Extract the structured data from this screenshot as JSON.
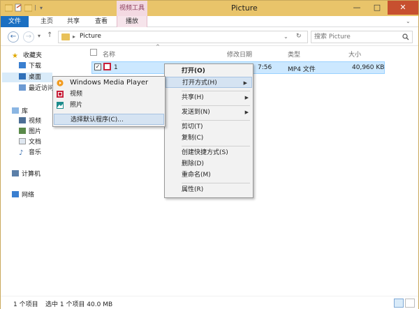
{
  "window": {
    "title": "Picture"
  },
  "ribbon": {
    "contextual_group": "视频工具",
    "tabs": [
      "文件",
      "主页",
      "共享",
      "查看",
      "播放"
    ]
  },
  "address": {
    "path": "Picture",
    "search_placeholder": "搜索 Picture"
  },
  "nav": {
    "favorites": "收藏夹",
    "downloads": "下载",
    "desktop": "桌面",
    "recent": "最近访问的位置",
    "libraries": "库",
    "videos": "视频",
    "pictures": "图片",
    "documents": "文档",
    "music": "音乐",
    "computer": "计算机",
    "network": "网络"
  },
  "columns": {
    "name": "名称",
    "date": "修改日期",
    "type": "类型",
    "size": "大小"
  },
  "file": {
    "name": "1",
    "date": "7:56",
    "type": "MP4 文件",
    "size": "40,960 KB"
  },
  "context_menu": {
    "open": "打开(O)",
    "open_with": "打开方式(H)",
    "share": "共享(H)",
    "send_to": "发送到(N)",
    "cut": "剪切(T)",
    "copy": "复制(C)",
    "create_shortcut": "创建快捷方式(S)",
    "delete": "删除(D)",
    "rename": "重命名(M)",
    "properties": "属性(R)"
  },
  "open_with_menu": {
    "wmp": "Windows Media Player",
    "video": "视频",
    "photos": "照片",
    "choose_default": "选择默认程序(C)..."
  },
  "status": {
    "count": "1 个项目",
    "selected": "选中 1 个项目 40.0 MB"
  },
  "colors": {
    "titlebar": "#e9c46a",
    "file_tab": "#1a6fc2",
    "selection": "#cce8ff",
    "close": "#c7502f"
  }
}
